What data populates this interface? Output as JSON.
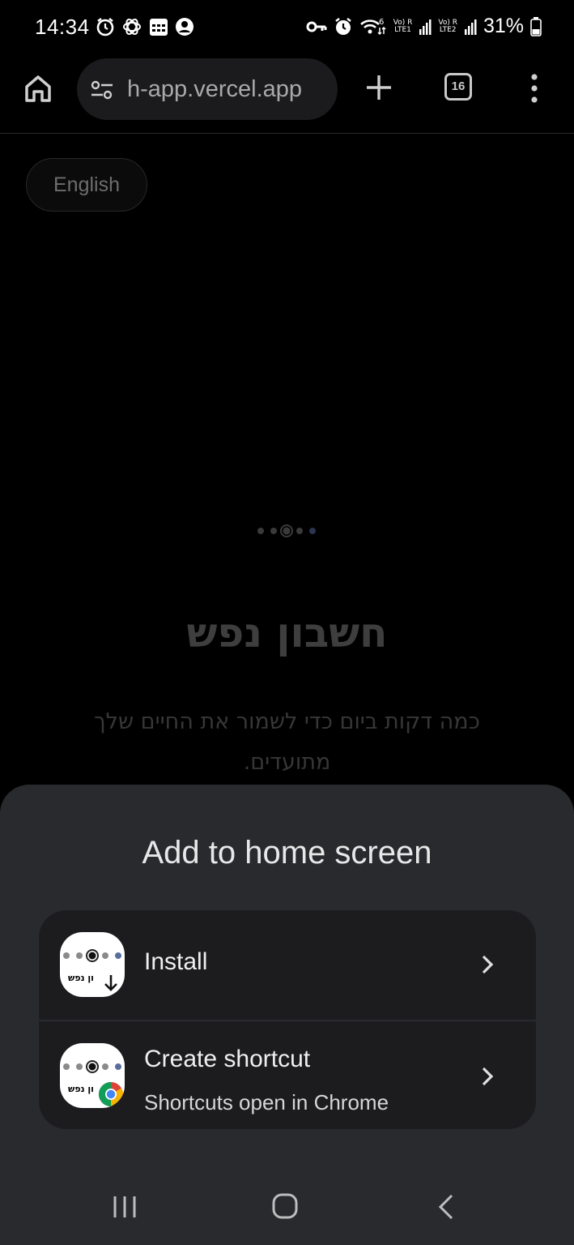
{
  "status_bar": {
    "time": "14:34",
    "left_icons": [
      "alarm-icon",
      "chatgpt-icon",
      "calendar-icon",
      "account-icon"
    ],
    "right_icons": [
      "vpn-key-icon",
      "alarm-icon",
      "wifi-icon",
      "lte1-signal-icon",
      "lte2-signal-icon",
      "battery-icon"
    ],
    "wifi_label": "6",
    "lte1_label": "Vo) R\nLTE1",
    "lte2_label": "Vo) R\nLTE2",
    "battery_percent": "31%"
  },
  "browser": {
    "url": "h-app.vercel.app",
    "tab_count": "16"
  },
  "page": {
    "language_button": "English",
    "title": "חשבון נפש",
    "subtitle": "כמה דקות ביום כדי לשמור את החיים שלך מתועדים."
  },
  "sheet": {
    "title": "Add to home screen",
    "options": [
      {
        "label": "Install",
        "icon": "download-badge-icon"
      },
      {
        "label": "Create shortcut",
        "sublabel": "Shortcuts open in Chrome",
        "icon": "chrome-badge-icon"
      }
    ],
    "app_icon_text": "ון נפש"
  },
  "colors": {
    "background": "#000000",
    "sheet": "#292a2e",
    "option_card": "#1c1c1f",
    "accent_dot": "#5a6e9e"
  }
}
